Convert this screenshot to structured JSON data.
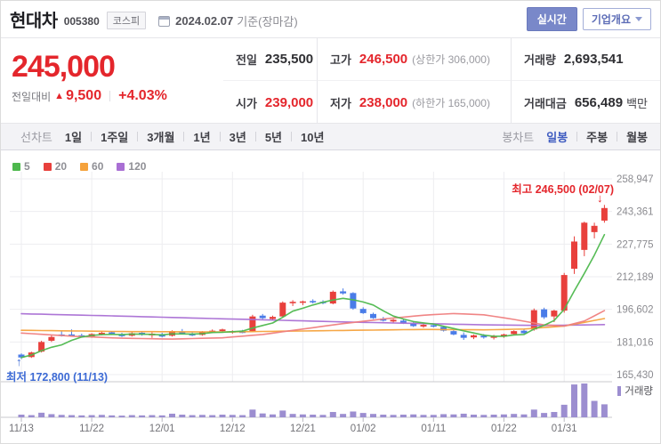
{
  "header": {
    "title": "현대차",
    "code": "005380",
    "market_badge": "코스피",
    "date": "2024.02.07",
    "date_suffix": "기준(장마감)",
    "realtime_button": "실시간",
    "overview_button": "기업개요"
  },
  "quote": {
    "price": "245,000",
    "change_label": "전일대비",
    "change_arrow": "▲",
    "change_value": "9,500",
    "change_percent": "+4.03%",
    "prev_label": "전일",
    "prev_value": "235,500",
    "high_label": "고가",
    "high_value": "246,500",
    "upper_limit": "(상한가 306,000)",
    "open_label": "시가",
    "open_value": "239,000",
    "low_label": "저가",
    "low_value": "238,000",
    "lower_limit": "(하한가 165,000)",
    "volume_label": "거래량",
    "volume_value": "2,693,541",
    "amount_label": "거래대금",
    "amount_value": "656,489",
    "amount_unit": "백만"
  },
  "nav": {
    "line_label": "선차트",
    "line_items": [
      "1일",
      "1주일",
      "3개월",
      "1년",
      "3년",
      "5년",
      "10년"
    ],
    "candle_label": "봉차트",
    "candle_items": [
      "일봉",
      "주봉",
      "월봉"
    ],
    "selected_candle": "일봉"
  },
  "chart_data": {
    "type": "candlestick",
    "title": "현대차 일봉 차트",
    "legend": [
      {
        "label": "5",
        "color": "#4db84d"
      },
      {
        "label": "20",
        "color": "#e8403c"
      },
      {
        "label": "60",
        "color": "#f5a23c"
      },
      {
        "label": "120",
        "color": "#a96fd4"
      }
    ],
    "y_ticks": [
      258947,
      243361,
      227775,
      212189,
      196602,
      181016,
      165430
    ],
    "x_tick_labels": [
      "11/13",
      "11/22",
      "12/01",
      "12/12",
      "12/21",
      "01/02",
      "01/11",
      "01/22",
      "01/31"
    ],
    "x_tick_indices": [
      0,
      7,
      14,
      21,
      28,
      34,
      41,
      48,
      54
    ],
    "annotations": {
      "high": {
        "label": "최고",
        "value": "246,500",
        "date": "(02/07)",
        "arrow": "↓"
      },
      "low": {
        "label": "최저",
        "value": "172,800",
        "date": "(11/13)",
        "arrow": "↑"
      }
    },
    "volume_legend": "거래량",
    "colors": {
      "up": "#e8403c",
      "down": "#4a7ce8",
      "ma5": "#4db84d",
      "ma20": "#ef7e7e",
      "ma60": "#f5a23c",
      "ma120": "#a96fd4",
      "volume": "#9c8ed0"
    },
    "candles": [
      [
        175000,
        175600,
        172800,
        173600
      ],
      [
        173800,
        176400,
        173400,
        176000
      ],
      [
        176400,
        181600,
        176000,
        181000
      ],
      [
        181600,
        184200,
        181000,
        183400
      ],
      [
        184600,
        186400,
        183600,
        184200
      ],
      [
        184600,
        187000,
        184000,
        184400
      ],
      [
        184200,
        185000,
        183200,
        183800
      ],
      [
        183600,
        185200,
        183000,
        184800
      ],
      [
        185000,
        186000,
        184200,
        185400
      ],
      [
        185600,
        186200,
        184400,
        184800
      ],
      [
        184600,
        185400,
        183400,
        183800
      ],
      [
        184000,
        185800,
        183600,
        185200
      ],
      [
        185400,
        186000,
        184000,
        184400
      ],
      [
        184200,
        185600,
        183000,
        185000
      ],
      [
        184800,
        185400,
        183200,
        183600
      ],
      [
        184000,
        186600,
        183600,
        186200
      ],
      [
        186000,
        187200,
        184600,
        185000
      ],
      [
        184800,
        185600,
        183800,
        184200
      ],
      [
        184400,
        186200,
        184000,
        185800
      ],
      [
        186000,
        187000,
        185200,
        186400
      ],
      [
        186200,
        187400,
        185400,
        187000
      ],
      [
        185800,
        186600,
        185000,
        186200
      ],
      [
        186000,
        186800,
        185200,
        185600
      ],
      [
        186200,
        194000,
        185800,
        193200
      ],
      [
        193600,
        194400,
        191800,
        192400
      ],
      [
        192000,
        193600,
        191200,
        193000
      ],
      [
        193200,
        200400,
        192800,
        199800
      ],
      [
        199600,
        201000,
        198200,
        200200
      ],
      [
        199800,
        200800,
        198600,
        200400
      ],
      [
        200600,
        201400,
        199400,
        200000
      ],
      [
        200200,
        201000,
        199000,
        199600
      ],
      [
        199400,
        205600,
        199000,
        205000
      ],
      [
        205200,
        206600,
        203600,
        204200
      ],
      [
        204400,
        204800,
        196400,
        197000
      ],
      [
        196800,
        197600,
        194400,
        194800
      ],
      [
        194400,
        195000,
        192000,
        192400
      ],
      [
        192200,
        193000,
        190800,
        191200
      ],
      [
        190800,
        192000,
        190200,
        191600
      ],
      [
        191200,
        191800,
        189600,
        190000
      ],
      [
        189800,
        190600,
        188200,
        188600
      ],
      [
        188400,
        189600,
        187800,
        189200
      ],
      [
        189000,
        189800,
        188000,
        188400
      ],
      [
        188200,
        188800,
        186000,
        186400
      ],
      [
        186200,
        186800,
        184200,
        184600
      ],
      [
        184400,
        185600,
        182000,
        183000
      ],
      [
        183200,
        184600,
        182400,
        184200
      ],
      [
        184000,
        184800,
        182600,
        183200
      ],
      [
        183000,
        184400,
        182200,
        183800
      ],
      [
        183600,
        185000,
        183000,
        184600
      ],
      [
        184800,
        186600,
        184200,
        186200
      ],
      [
        186400,
        187000,
        184800,
        185200
      ],
      [
        187000,
        197000,
        186400,
        196200
      ],
      [
        196600,
        197400,
        192000,
        192800
      ],
      [
        193200,
        196400,
        190500,
        196000
      ],
      [
        196000,
        214000,
        195000,
        213000
      ],
      [
        216000,
        231500,
        213500,
        229000
      ],
      [
        225000,
        238500,
        222000,
        238000
      ],
      [
        233500,
        238000,
        230500,
        236500
      ],
      [
        239000,
        246500,
        238000,
        245000
      ]
    ],
    "volumes_millions": [
      0.55,
      0.45,
      0.95,
      0.65,
      0.5,
      0.45,
      0.4,
      0.45,
      0.5,
      0.4,
      0.35,
      0.45,
      0.4,
      0.45,
      0.4,
      0.75,
      0.55,
      0.45,
      0.5,
      0.45,
      0.55,
      0.5,
      0.45,
      1.6,
      0.8,
      0.6,
      1.4,
      0.7,
      0.6,
      0.55,
      0.5,
      1.1,
      0.7,
      1.2,
      0.9,
      0.7,
      0.55,
      0.5,
      0.55,
      0.6,
      0.5,
      0.5,
      0.65,
      0.6,
      0.75,
      0.55,
      0.5,
      0.55,
      0.6,
      0.7,
      0.6,
      1.6,
      0.9,
      1.1,
      2.6,
      6.8,
      7.0,
      3.4,
      2.69
    ],
    "ma_points": {
      "ma20": [
        [
          0,
          185300
        ],
        [
          5,
          183800
        ],
        [
          10,
          182800
        ],
        [
          15,
          182400
        ],
        [
          20,
          183000
        ],
        [
          24,
          184600
        ],
        [
          28,
          187200
        ],
        [
          32,
          189800
        ],
        [
          36,
          192000
        ],
        [
          40,
          193800
        ],
        [
          43,
          194600
        ],
        [
          46,
          194000
        ],
        [
          49,
          191800
        ],
        [
          52,
          189200
        ],
        [
          54,
          188600
        ],
        [
          56,
          191000
        ],
        [
          58,
          196000
        ]
      ],
      "ma60": [
        [
          0,
          186600
        ],
        [
          10,
          186000
        ],
        [
          20,
          185800
        ],
        [
          30,
          186400
        ],
        [
          40,
          187000
        ],
        [
          46,
          186800
        ],
        [
          50,
          187200
        ],
        [
          54,
          188600
        ],
        [
          58,
          192200
        ]
      ],
      "ma120": [
        [
          0,
          194500
        ],
        [
          8,
          193600
        ],
        [
          16,
          192600
        ],
        [
          24,
          191600
        ],
        [
          32,
          190600
        ],
        [
          40,
          189800
        ],
        [
          46,
          189200
        ],
        [
          52,
          188900
        ],
        [
          58,
          189300
        ]
      ]
    }
  }
}
